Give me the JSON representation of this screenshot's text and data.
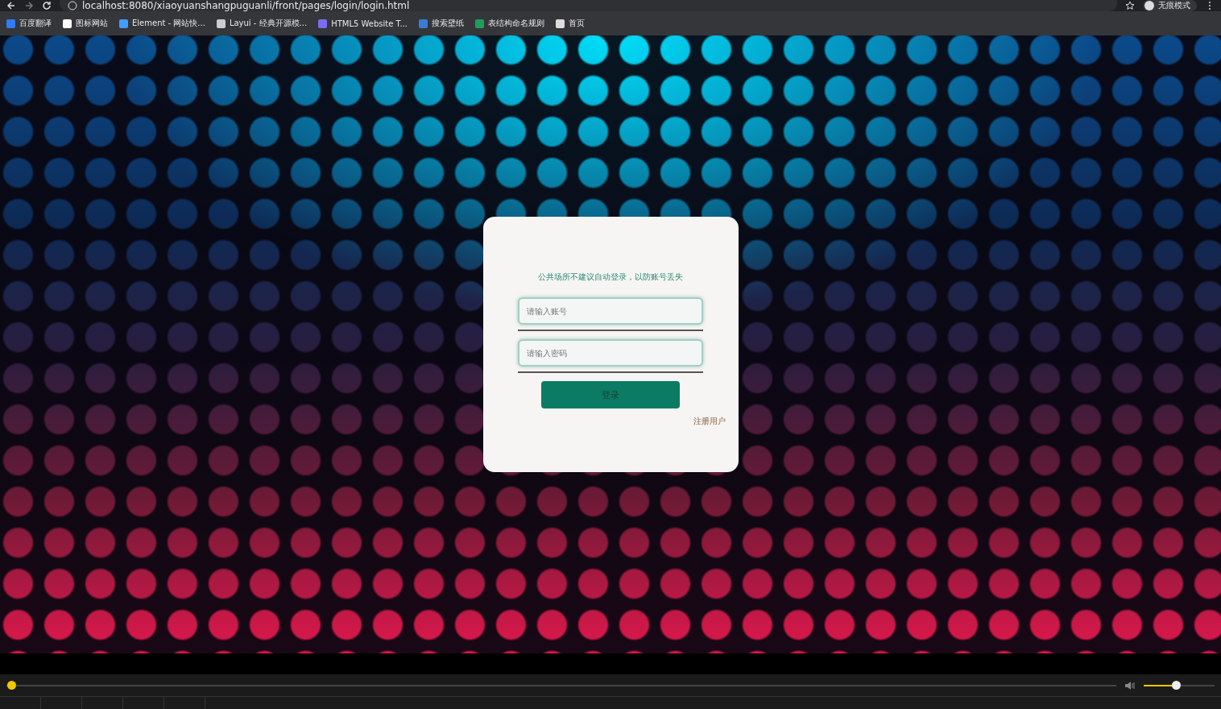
{
  "browser": {
    "url": "localhost:8080/xiaoyuanshangpuguanli/front/pages/login/login.html",
    "profile_label": "无痕模式",
    "bookmarks": [
      {
        "label": "百度翻译",
        "color": "#2f7cf6"
      },
      {
        "label": "图标网站",
        "color": "#ffffff"
      },
      {
        "label": "Element - 网站快...",
        "color": "#409eff"
      },
      {
        "label": "Layui - 经典开源模...",
        "color": "#cccccc"
      },
      {
        "label": "HTML5 Website T...",
        "color": "#7b6cf0"
      },
      {
        "label": "搜索壁纸",
        "color": "#3a7bd5"
      },
      {
        "label": "表结构命名规则",
        "color": "#1e9e5a"
      },
      {
        "label": "首页",
        "color": "#dddddd"
      }
    ]
  },
  "login": {
    "notice": "公共场所不建议自动登录，以防账号丢失",
    "username_placeholder": "请输入账号",
    "password_placeholder": "请输入密码",
    "login_button": "登录",
    "register_link": "注册用户"
  },
  "player": {
    "progress": {
      "level": 0
    },
    "volume": {
      "level": 0.45
    }
  }
}
